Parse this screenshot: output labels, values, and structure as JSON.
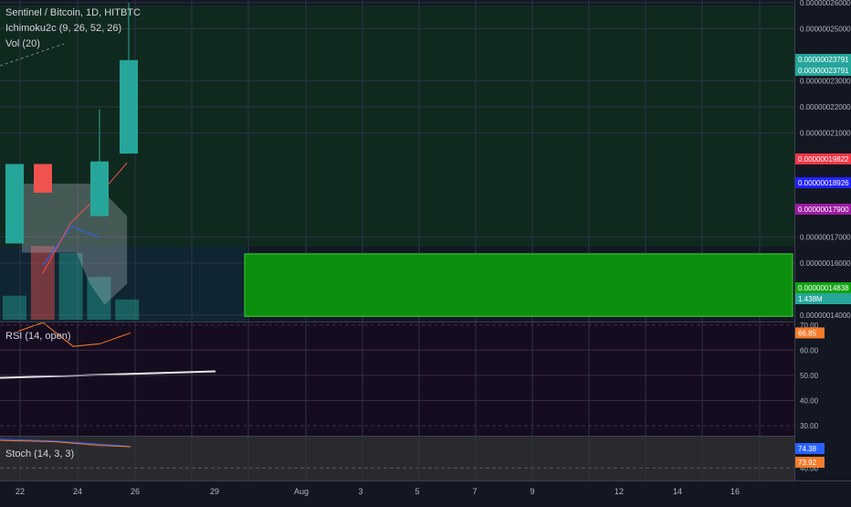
{
  "chart_data": {
    "type": "candlestick",
    "title": "Sentinel / Bitcoin, 1D, HITBTC",
    "indicators": [
      "Ichimoku2c (9, 26, 52, 26)",
      "Vol (20)"
    ],
    "x_axis_labels": [
      "22",
      "24",
      "26",
      "29",
      "Aug",
      "3",
      "5",
      "7",
      "9",
      "12",
      "14",
      "16"
    ],
    "price_axis": {
      "ticks": [
        "0.00000026000",
        "0.00000025000",
        "0.00000023000",
        "0.00000022000",
        "0.00000021000",
        "0.00000017000",
        "0.00000016000",
        "0.00000014000"
      ],
      "ylim": [
        1.375e-07,
        2.61e-07
      ]
    },
    "price_labels": [
      {
        "text": "0.00000023791",
        "color": "#26a69a"
      },
      {
        "text": "0.00000023791",
        "color": "#26a69a"
      },
      {
        "text": "0.00000019822",
        "color": "#f23645"
      },
      {
        "text": "0.00000018926",
        "color": "#2121ff"
      },
      {
        "text": "0.00000017900",
        "color": "#9c1ca1"
      },
      {
        "text": "0.00000014838",
        "color": "#13a313"
      },
      {
        "text": "1.438M",
        "color": "#26a69a"
      }
    ],
    "candles": [
      {
        "open": 1.675e-07,
        "high": 1.98e-07,
        "low": 1.675e-07,
        "close": 1.98e-07,
        "color": "#26a69a"
      },
      {
        "open": 1.98e-07,
        "high": 1.98e-07,
        "low": 1.87e-07,
        "close": 1.87e-07,
        "color": "#ef5350"
      },
      {
        "open": 1.78e-07,
        "high": 2.19e-07,
        "low": 1.78e-07,
        "close": 1.99e-07,
        "color": "#26a69a"
      },
      {
        "open": 2.02e-07,
        "high": 2.6e-07,
        "low": 2.02e-07,
        "close": 2.379e-07,
        "color": "#26a69a"
      }
    ],
    "volume_max": 1.438,
    "volume": [
      0.45,
      1.38,
      1.25,
      0.8,
      0.38
    ],
    "rsi": {
      "label": "RSI (14, open)",
      "ticks": [
        "70.00",
        "60.00",
        "50.00",
        "40.00",
        "30.00"
      ],
      "current": "66.85",
      "ylim": [
        26,
        71
      ]
    },
    "stoch": {
      "label": "Stoch (14, 3, 3)",
      "ticks": [
        "40.00"
      ],
      "values": [
        "74.38",
        "73.92"
      ],
      "ylim": [
        20,
        90
      ]
    },
    "colors": {
      "bull": "#26a69a",
      "bear": "#ef5350",
      "target_box": "#0c8f0c",
      "cloud_bg": "#10291f"
    }
  }
}
